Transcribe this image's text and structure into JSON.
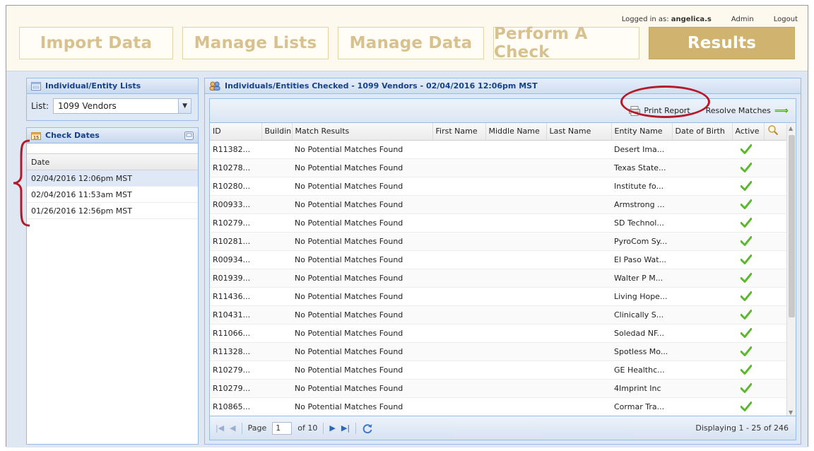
{
  "header": {
    "logged_in_label": "Logged in as:",
    "username": "angelica.s",
    "admin_link": "Admin",
    "logout_link": "Logout",
    "tabs": [
      {
        "label": "Import Data"
      },
      {
        "label": "Manage Lists"
      },
      {
        "label": "Manage Data"
      },
      {
        "label": "Perform A Check"
      },
      {
        "label": "Results"
      }
    ]
  },
  "lists_panel": {
    "title": "Individual/Entity Lists",
    "list_label": "List:",
    "selected_list": "1099 Vendors"
  },
  "dates_panel": {
    "title": "Check Dates",
    "column": "Date",
    "rows": [
      "02/04/2016 12:06pm MST",
      "02/04/2016 11:53am MST",
      "01/26/2016 12:56pm MST"
    ]
  },
  "results_panel": {
    "title": "Individuals/Entities Checked - 1099 Vendors - 02/04/2016 12:06pm MST",
    "print_report": "Print Report",
    "resolve_matches": "Resolve Matches",
    "columns": [
      "ID",
      "Buildin",
      "Match Results",
      "First Name",
      "Middle Name",
      "Last Name",
      "Entity Name",
      "Date of Birth",
      "Active"
    ],
    "rows": [
      {
        "id": "R11382...",
        "match": "No Potential Matches Found",
        "entity": "Desert Ima..."
      },
      {
        "id": "R10278...",
        "match": "No Potential Matches Found",
        "entity": "Texas State..."
      },
      {
        "id": "R10280...",
        "match": "No Potential Matches Found",
        "entity": "Institute fo..."
      },
      {
        "id": "R00933...",
        "match": "No Potential Matches Found",
        "entity": "Armstrong ..."
      },
      {
        "id": "R10279...",
        "match": "No Potential Matches Found",
        "entity": "SD Technol..."
      },
      {
        "id": "R10281...",
        "match": "No Potential Matches Found",
        "entity": "PyroCom Sy..."
      },
      {
        "id": "R00934...",
        "match": "No Potential Matches Found",
        "entity": "El Paso Wat..."
      },
      {
        "id": "R01939...",
        "match": "No Potential Matches Found",
        "entity": "Walter P M..."
      },
      {
        "id": "R11436...",
        "match": "No Potential Matches Found",
        "entity": "Living Hope..."
      },
      {
        "id": "R10431...",
        "match": "No Potential Matches Found",
        "entity": "Clinically S..."
      },
      {
        "id": "R11066...",
        "match": "No Potential Matches Found",
        "entity": "Soledad NF..."
      },
      {
        "id": "R11328...",
        "match": "No Potential Matches Found",
        "entity": "Spotless Mo..."
      },
      {
        "id": "R10279...",
        "match": "No Potential Matches Found",
        "entity": "GE Healthc..."
      },
      {
        "id": "R10279...",
        "match": "No Potential Matches Found",
        "entity": "4Imprint Inc"
      },
      {
        "id": "R10865...",
        "match": "No Potential Matches Found",
        "entity": "Cormar Tra..."
      }
    ],
    "pager": {
      "page_label": "Page",
      "page_value": "1",
      "of_label": "of 10",
      "displaying": "Displaying 1 - 25 of 246"
    }
  },
  "colors": {
    "tab_active_bg": "#cfb36e",
    "tab_inactive_text": "#d7c18f",
    "panel_header_text": "#15428b",
    "annotation_red": "#b51a28",
    "check_green": "#5cb82e"
  }
}
